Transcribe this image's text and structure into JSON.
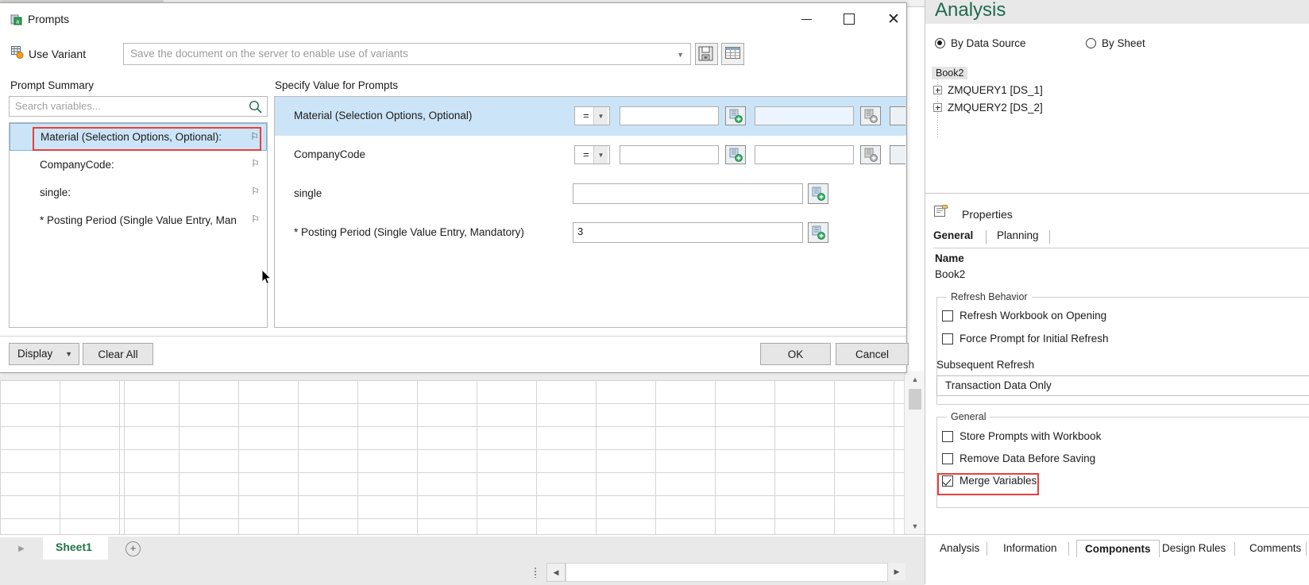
{
  "dialog": {
    "title": "Prompts",
    "icon": "prompts-icon",
    "window_controls": {
      "minimize": "–",
      "maximize": "☐",
      "close": "✕"
    },
    "variant": {
      "label": "Use Variant",
      "input_value": "",
      "placeholder": "Save the document on the server to enable use of variants",
      "save_icon": "save-icon",
      "list_icon": "variant-list-icon"
    },
    "summary": {
      "heading": "Prompt Summary",
      "search_placeholder": "Search variables...",
      "search_value": "",
      "items": [
        {
          "label": "Material (Selection Options, Optional):",
          "pin": "⚐",
          "selected": true,
          "highlighted": true
        },
        {
          "label": "CompanyCode:",
          "pin": "⚐",
          "selected": false,
          "highlighted": false
        },
        {
          "label": "single:",
          "pin": "⚐",
          "selected": false,
          "highlighted": false
        },
        {
          "label": "* Posting Period (Single Value Entry, Man",
          "pin": "⚐",
          "selected": false,
          "highlighted": false
        }
      ]
    },
    "specify": {
      "heading": "Specify Value for Prompts",
      "rows": [
        {
          "label": "Material (Selection Options, Optional)",
          "operator": "=",
          "value1": "",
          "value2": "",
          "selected": true,
          "has_operator": true,
          "has_range": true
        },
        {
          "label": "CompanyCode",
          "operator": "=",
          "value1": "",
          "value2": "",
          "selected": false,
          "has_operator": true,
          "has_range": true
        },
        {
          "label": "single",
          "operator": "",
          "value1": "",
          "value2": "",
          "selected": false,
          "has_operator": false,
          "has_range": false
        },
        {
          "label": "* Posting Period (Single Value Entry, Mandatory)",
          "operator": "",
          "value1": "3",
          "value2": "",
          "selected": false,
          "has_operator": false,
          "has_range": false
        }
      ]
    },
    "footer": {
      "display_label": "Display",
      "clear_all_label": "Clear All",
      "ok_label": "OK",
      "cancel_label": "Cancel"
    }
  },
  "analysis": {
    "title": "Analysis",
    "view_modes": [
      {
        "label": "By Data Source",
        "selected": true
      },
      {
        "label": "By Sheet",
        "selected": false
      }
    ],
    "tree": {
      "root": "Book2",
      "nodes": [
        {
          "label": "ZMQUERY1 [DS_1]"
        },
        {
          "label": "ZMQUERY2 [DS_2]"
        }
      ]
    },
    "properties": {
      "heading": "Properties",
      "icon": "properties-icon",
      "tabs": [
        {
          "label": "General",
          "active": true
        },
        {
          "label": "Planning",
          "active": false
        }
      ],
      "name_label": "Name",
      "name_value": "Book2",
      "refresh_group": {
        "title": "Refresh Behavior",
        "checkboxes": [
          {
            "label": "Refresh Workbook on Opening",
            "checked": false
          },
          {
            "label": "Force Prompt for Initial Refresh",
            "checked": false
          }
        ],
        "subsequent_label": "Subsequent Refresh",
        "subsequent_value": "Transaction Data Only"
      },
      "general_group": {
        "title": "General",
        "checkboxes": [
          {
            "label": "Store Prompts with Workbook",
            "checked": false,
            "highlighted": false
          },
          {
            "label": "Remove Data Before Saving",
            "checked": false,
            "highlighted": false
          },
          {
            "label": "Merge Variables",
            "checked": true,
            "highlighted": true
          }
        ]
      }
    },
    "bottom_tabs": [
      {
        "label": "Analysis",
        "active": false
      },
      {
        "label": "Information",
        "active": false
      },
      {
        "label": "Components",
        "active": true
      },
      {
        "label": "Design Rules",
        "active": false
      },
      {
        "label": "Comments",
        "active": false
      }
    ]
  },
  "excel": {
    "sheet_tab": "Sheet1",
    "add_sheet_icon": "plus-circle-icon"
  },
  "colors": {
    "accent_green": "#217346",
    "analysis_green": "#1f6b4f",
    "selection_blue": "#cce4f7",
    "highlight_red": "#e8403a"
  }
}
